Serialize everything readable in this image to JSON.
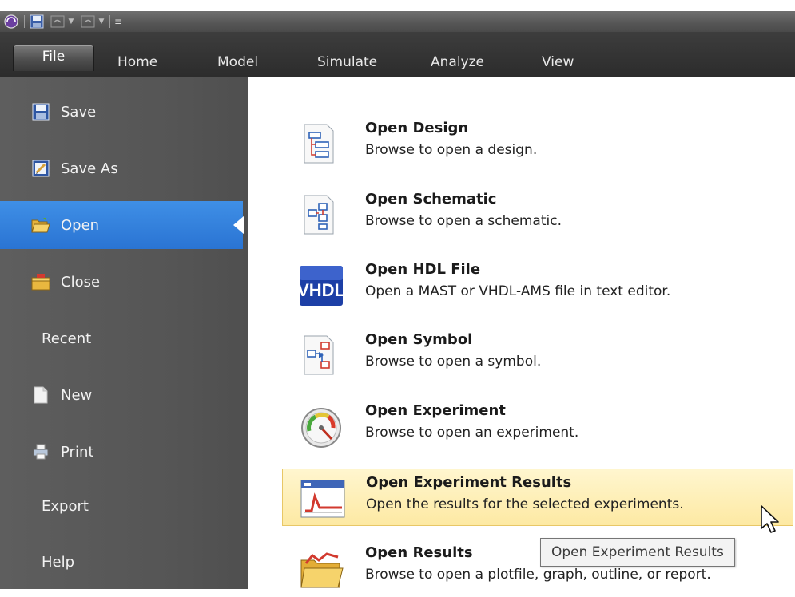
{
  "quick_access": {
    "icons": [
      "app-orb-icon",
      "save-icon",
      "undo-icon",
      "redo-icon",
      "customize-icon"
    ]
  },
  "tabs": {
    "file": "File",
    "home": "Home",
    "model": "Model",
    "simulate": "Simulate",
    "analyze": "Analyze",
    "view": "View"
  },
  "sidebar": {
    "items": [
      {
        "label": "Save",
        "icon": "save-icon"
      },
      {
        "label": "Save As",
        "icon": "save-as-icon"
      },
      {
        "label": "Open",
        "icon": "open-folder-icon",
        "active": true
      },
      {
        "label": "Close",
        "icon": "close-folder-icon"
      },
      {
        "label": "Recent"
      },
      {
        "label": "New",
        "icon": "new-document-icon"
      },
      {
        "label": "Print",
        "icon": "printer-icon"
      },
      {
        "label": "Export"
      },
      {
        "label": "Help"
      }
    ]
  },
  "commands": [
    {
      "title": "Open Design",
      "desc": "Browse to open a design.",
      "icon": "design-tree-icon"
    },
    {
      "title": "Open Schematic",
      "desc": "Browse to open a schematic.",
      "icon": "schematic-icon"
    },
    {
      "title": "Open HDL File",
      "desc": "Open a MAST or VHDL-AMS file in text editor.",
      "icon": "vhdl-icon",
      "icon_text": "VHDL"
    },
    {
      "title": "Open Symbol",
      "desc": "Browse to open a symbol.",
      "icon": "symbol-icon"
    },
    {
      "title": "Open Experiment",
      "desc": "Browse to open an experiment.",
      "icon": "gauge-icon"
    },
    {
      "title": "Open Experiment Results",
      "desc": "Open the results for the selected experiments.",
      "icon": "results-window-icon",
      "highlighted": true
    },
    {
      "title": "Open Results",
      "desc": "Browse to open a plotfile, graph, outline, or report.",
      "icon": "results-folder-icon"
    }
  ],
  "tooltip": "Open Experiment Results",
  "colors": {
    "accent": "#2f7fdc",
    "highlight": "#fde9a3",
    "sidebar": "#585858",
    "tabbar": "#333333"
  }
}
